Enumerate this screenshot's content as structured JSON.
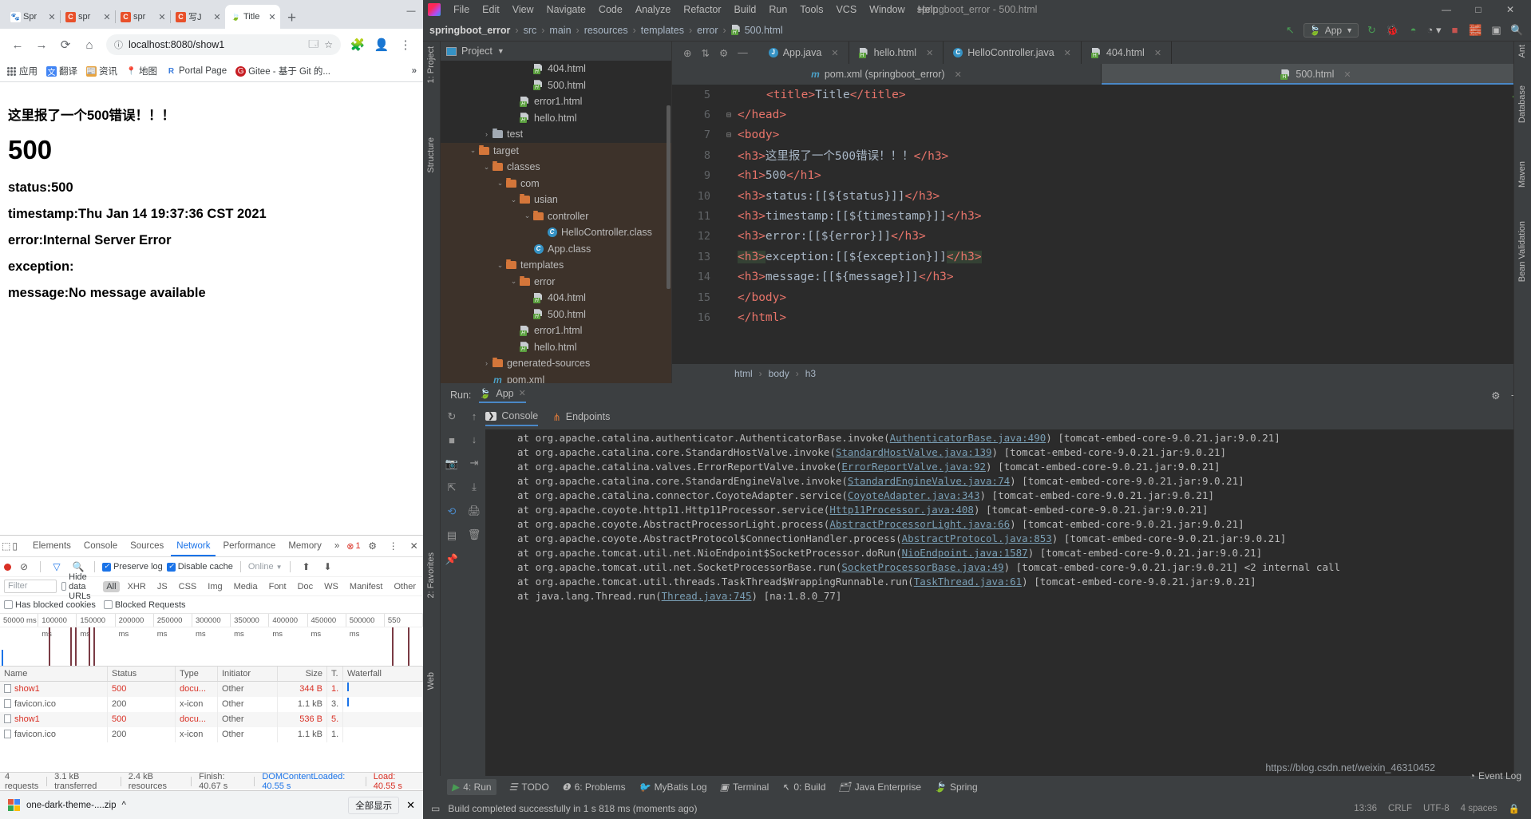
{
  "browser": {
    "tabs": [
      {
        "title": "Spr",
        "icon": "baidu-favicon",
        "active": false
      },
      {
        "title": "spr",
        "icon": "csdn-favicon",
        "active": false
      },
      {
        "title": "spr",
        "icon": "csdn-favicon",
        "active": false
      },
      {
        "title": "写J",
        "icon": "csdn-favicon",
        "active": false
      },
      {
        "title": "Title",
        "icon": "leaf-favicon",
        "active": true
      }
    ],
    "newtab_label": "+",
    "window_buttons": [
      "—",
      "□",
      "✕"
    ],
    "nav": {
      "back": "←",
      "forward": "→",
      "reload": "⟳",
      "home": "⌂"
    },
    "omnibox": {
      "info_icon": "ⓘ",
      "url": "localhost:8080/show1",
      "translate_icon": "translate-icon",
      "star_icon": "☆"
    },
    "toolbar_icons": [
      "puzzle-icon",
      "profile-icon",
      "menu-icon"
    ],
    "bookmarks": [
      {
        "label": "应用",
        "icon": "apps-grid"
      },
      {
        "label": "翻译",
        "icon": "translate"
      },
      {
        "label": "资讯",
        "icon": "news"
      },
      {
        "label": "地图",
        "icon": "maps"
      },
      {
        "label": "Portal Page",
        "icon": "portal"
      },
      {
        "label": "Gitee - 基于 Git 的...",
        "icon": "gitee"
      }
    ],
    "bookmarks_overflow": "»",
    "page": {
      "h3_error": "这里报了一个500错误！！！",
      "h1_code": "500",
      "status": "status:500",
      "timestamp": "timestamp:Thu Jan 14 19:37:36 CST 2021",
      "error": "error:Internal Server Error",
      "exception": "exception:",
      "message": "message:No message available"
    }
  },
  "devtools": {
    "tabs": [
      "Elements",
      "Console",
      "Sources",
      "Network",
      "Performance",
      "Memory"
    ],
    "active_tab": "Network",
    "overflow": "»",
    "error_count": "1",
    "settings_icon": "gear-icon",
    "more_icon": "kebab-icon",
    "close_icon": "✕",
    "inspect_icon": "inspect-icon",
    "device_icon": "device-toolbar-icon",
    "toolbar": {
      "record": "record-dot",
      "clear": "clear-icon",
      "filter": "filter-icon",
      "search": "search-icon",
      "preserve_log": "Preserve log",
      "preserve_log_checked": true,
      "disable_cache": "Disable cache",
      "disable_cache_checked": true,
      "throttle": "Online",
      "import_icon": "⬆",
      "export_icon": "⬇"
    },
    "filterbar": {
      "placeholder": "Filter",
      "hide_data_urls": "Hide data URLs",
      "types": [
        "All",
        "XHR",
        "JS",
        "CSS",
        "Img",
        "Media",
        "Font",
        "Doc",
        "WS",
        "Manifest",
        "Other"
      ],
      "active_type": "All",
      "has_blocked_cookies": "Has blocked cookies",
      "blocked_requests": "Blocked Requests"
    },
    "overview_ticks": [
      "50000 ms",
      "100000 ms",
      "150000 ms",
      "200000 ms",
      "250000 ms",
      "300000 ms",
      "350000 ms",
      "400000 ms",
      "450000 ms",
      "500000 ms",
      "550"
    ],
    "table": {
      "headers": [
        "Name",
        "Status",
        "Type",
        "Initiator",
        "Size",
        "T.",
        "Waterfall"
      ],
      "rows": [
        {
          "name": "show1",
          "status": "500",
          "type": "docu...",
          "initiator": "Other",
          "size": "344 B",
          "time": "1.",
          "error": true
        },
        {
          "name": "favicon.ico",
          "status": "200",
          "type": "x-icon",
          "initiator": "Other",
          "size": "1.1 kB",
          "time": "3.",
          "error": false
        },
        {
          "name": "show1",
          "status": "500",
          "type": "docu...",
          "initiator": "Other",
          "size": "536 B",
          "time": "5.",
          "error": true
        },
        {
          "name": "favicon.ico",
          "status": "200",
          "type": "x-icon",
          "initiator": "Other",
          "size": "1.1 kB",
          "time": "1.",
          "error": false
        }
      ]
    },
    "summary": {
      "requests": "4 requests",
      "transferred": "3.1 kB transferred",
      "resources": "2.4 kB resources",
      "finish": "Finish: 40.67 s",
      "dcl": "DOMContentLoaded: 40.55 s",
      "load": "Load: 40.55 s"
    }
  },
  "download_bar": {
    "file": "one-dark-theme-....zip",
    "chevron": "^",
    "show_all": "全部显示",
    "close": "✕"
  },
  "ide": {
    "window_title": "springboot_error - 500.html",
    "menu": [
      "File",
      "Edit",
      "View",
      "Navigate",
      "Code",
      "Analyze",
      "Refactor",
      "Build",
      "Run",
      "Tools",
      "VCS",
      "Window",
      "Help"
    ],
    "window_buttons": [
      "—",
      "□",
      "✕"
    ],
    "breadcrumbs": [
      "springboot_error",
      "src",
      "main",
      "resources",
      "templates",
      "error",
      "500.html"
    ],
    "run_config": "App",
    "toolbar_icons": [
      "back-arrow-icon",
      "run-icon",
      "debug-icon",
      "run-coverage-icon",
      "profile-icon",
      "stop-icon",
      "build-icon",
      "terminal-icon",
      "search-icon"
    ],
    "project_panel": {
      "title": "Project",
      "vertical_tab": "1: Project",
      "toolbar_icons": [
        "locate-icon",
        "collapse-icon",
        "settings-icon",
        "hide-icon"
      ],
      "tree": [
        {
          "label": "404.html",
          "icon": "html",
          "indent": 6,
          "arrow": "",
          "highlight": false
        },
        {
          "label": "500.html",
          "icon": "html",
          "indent": 6,
          "arrow": "",
          "highlight": false
        },
        {
          "label": "error1.html",
          "icon": "html",
          "indent": 5,
          "arrow": "",
          "highlight": false
        },
        {
          "label": "hello.html",
          "icon": "html",
          "indent": 5,
          "arrow": "",
          "highlight": false
        },
        {
          "label": "test",
          "icon": "folder-grey",
          "indent": 3,
          "arrow": "›",
          "highlight": false
        },
        {
          "label": "target",
          "icon": "folder-orange",
          "indent": 2,
          "arrow": "⌄",
          "highlight": true
        },
        {
          "label": "classes",
          "icon": "folder-orange",
          "indent": 3,
          "arrow": "⌄",
          "highlight": true
        },
        {
          "label": "com",
          "icon": "folder-orange",
          "indent": 4,
          "arrow": "⌄",
          "highlight": true
        },
        {
          "label": "usian",
          "icon": "folder-orange",
          "indent": 5,
          "arrow": "⌄",
          "highlight": true
        },
        {
          "label": "controller",
          "icon": "folder-orange",
          "indent": 6,
          "arrow": "⌄",
          "highlight": true
        },
        {
          "label": "HelloController.class",
          "icon": "class",
          "indent": 7,
          "arrow": "",
          "highlight": true
        },
        {
          "label": "App.class",
          "icon": "class",
          "indent": 6,
          "arrow": "",
          "highlight": true
        },
        {
          "label": "templates",
          "icon": "folder-orange",
          "indent": 4,
          "arrow": "⌄",
          "highlight": true
        },
        {
          "label": "error",
          "icon": "folder-orange",
          "indent": 5,
          "arrow": "⌄",
          "highlight": true
        },
        {
          "label": "404.html",
          "icon": "html",
          "indent": 6,
          "arrow": "",
          "highlight": true
        },
        {
          "label": "500.html",
          "icon": "html",
          "indent": 6,
          "arrow": "",
          "highlight": true
        },
        {
          "label": "error1.html",
          "icon": "html",
          "indent": 5,
          "arrow": "",
          "highlight": true
        },
        {
          "label": "hello.html",
          "icon": "html",
          "indent": 5,
          "arrow": "",
          "highlight": true
        },
        {
          "label": "generated-sources",
          "icon": "folder-orange",
          "indent": 3,
          "arrow": "›",
          "highlight": true
        },
        {
          "label": "pom.xml",
          "icon": "maven",
          "indent": 3,
          "arrow": "",
          "highlight": true
        }
      ]
    },
    "editor": {
      "tabs_row1": [
        {
          "label": "App.java",
          "icon": "java-run",
          "active": false
        },
        {
          "label": "hello.html",
          "icon": "html",
          "active": false
        },
        {
          "label": "HelloController.java",
          "icon": "class",
          "active": false
        },
        {
          "label": "404.html",
          "icon": "html",
          "active": false
        }
      ],
      "tabs_row2": [
        {
          "label": "pom.xml (springboot_error)",
          "icon": "maven",
          "active": false
        },
        {
          "label": "500.html",
          "icon": "html",
          "active": true
        }
      ],
      "lines": [
        {
          "num": "5",
          "fold": "",
          "indent": 4,
          "segs": [
            [
              "ctag",
              "<title>"
            ],
            [
              "ptext",
              "Title"
            ],
            [
              "ctag",
              "</title>"
            ]
          ]
        },
        {
          "num": "6",
          "fold": "⊟",
          "indent": 0,
          "segs": [
            [
              "ctag",
              "</head>"
            ]
          ]
        },
        {
          "num": "7",
          "fold": "⊟",
          "indent": 0,
          "segs": [
            [
              "ctag",
              "<body>"
            ]
          ]
        },
        {
          "num": "8",
          "fold": "",
          "indent": 0,
          "segs": [
            [
              "ctag",
              "<h3>"
            ],
            [
              "ptext",
              "这里报了一个500错误！！！"
            ],
            [
              "ctag",
              "</h3>"
            ]
          ]
        },
        {
          "num": "9",
          "fold": "",
          "indent": 0,
          "segs": [
            [
              "ctag",
              "<h1>"
            ],
            [
              "ptext",
              "500"
            ],
            [
              "ctag",
              "</h1>"
            ]
          ]
        },
        {
          "num": "10",
          "fold": "",
          "indent": 0,
          "segs": [
            [
              "ctag",
              "<h3>"
            ],
            [
              "ptext",
              "status:[[${status}]]"
            ],
            [
              "ctag",
              "</h3>"
            ]
          ]
        },
        {
          "num": "11",
          "fold": "",
          "indent": 0,
          "segs": [
            [
              "ctag",
              "<h3>"
            ],
            [
              "ptext",
              "timestamp:[[${timestamp}]]"
            ],
            [
              "ctag",
              "</h3>"
            ]
          ]
        },
        {
          "num": "12",
          "fold": "",
          "indent": 0,
          "segs": [
            [
              "ctag",
              "<h3>"
            ],
            [
              "ptext",
              "error:[[${error}]]"
            ],
            [
              "ctag",
              "</h3>"
            ]
          ]
        },
        {
          "num": "13",
          "fold": "",
          "indent": 0,
          "segs": [
            [
              "ctag",
              "<h3>"
            ],
            [
              "ptext",
              "exception:[[${exception}]]"
            ],
            [
              "ctag",
              "</h3>"
            ]
          ],
          "selected": true
        },
        {
          "num": "14",
          "fold": "",
          "indent": 0,
          "segs": [
            [
              "ctag",
              "<h3>"
            ],
            [
              "ptext",
              "message:[[${message}]]"
            ],
            [
              "ctag",
              "</h3>"
            ]
          ]
        },
        {
          "num": "15",
          "fold": "",
          "indent": 0,
          "segs": [
            [
              "ctag",
              "</body>"
            ]
          ]
        },
        {
          "num": "16",
          "fold": "",
          "indent": 0,
          "segs": [
            [
              "ctag",
              "</html>"
            ]
          ]
        }
      ],
      "breadcrumb": [
        "html",
        "body",
        "h3"
      ],
      "inspection_ok": "✓"
    },
    "run_panel": {
      "label": "Run:",
      "config": "App",
      "close": "✕",
      "subtabs": [
        "Console",
        "Endpoints"
      ],
      "active_subtab": "Console",
      "settings_icon": "gear-icon",
      "minimize_icon": "—",
      "side_icons": [
        "rerun-icon",
        "stop-icon",
        "camera-icon",
        "thread-dump-icon",
        "scroll-end-icon",
        "soft-wrap-icon",
        "print-icon",
        "trash-icon",
        "pin-icon"
      ],
      "console_lines": [
        "at org.apache.catalina.authenticator.AuthenticatorBase.invoke(AuthenticatorBase.java:490) [tomcat-embed-core-9.0.21.jar:9.0.21]",
        "at org.apache.catalina.core.StandardHostValve.invoke(StandardHostValve.java:139) [tomcat-embed-core-9.0.21.jar:9.0.21]",
        "at org.apache.catalina.valves.ErrorReportValve.invoke(ErrorReportValve.java:92) [tomcat-embed-core-9.0.21.jar:9.0.21]",
        "at org.apache.catalina.core.StandardEngineValve.invoke(StandardEngineValve.java:74) [tomcat-embed-core-9.0.21.jar:9.0.21]",
        "at org.apache.catalina.connector.CoyoteAdapter.service(CoyoteAdapter.java:343) [tomcat-embed-core-9.0.21.jar:9.0.21]",
        "at org.apache.coyote.http11.Http11Processor.service(Http11Processor.java:408) [tomcat-embed-core-9.0.21.jar:9.0.21]",
        "at org.apache.coyote.AbstractProcessorLight.process(AbstractProcessorLight.java:66) [tomcat-embed-core-9.0.21.jar:9.0.21]",
        "at org.apache.coyote.AbstractProtocol$ConnectionHandler.process(AbstractProtocol.java:853) [tomcat-embed-core-9.0.21.jar:9.0.21]",
        "at org.apache.tomcat.util.net.NioEndpoint$SocketProcessor.doRun(NioEndpoint.java:1587) [tomcat-embed-core-9.0.21.jar:9.0.21]",
        "at org.apache.tomcat.util.net.SocketProcessorBase.run(SocketProcessorBase.java:49) [tomcat-embed-core-9.0.21.jar:9.0.21] <2 internal call",
        "at org.apache.tomcat.util.threads.TaskThread$WrappingRunnable.run(TaskThread.java:61) [tomcat-embed-core-9.0.21.jar:9.0.21]",
        "at java.lang.Thread.run(Thread.java:745) [na:1.8.0_77]"
      ]
    },
    "right_strip": [
      "Ant",
      "Database",
      "Maven",
      "Bean Validation"
    ],
    "left_strip_bottom": [
      "Structure",
      "2: Favorites",
      "Web"
    ],
    "tool_window_bar": [
      {
        "label": "4: Run",
        "icon": "run-icon",
        "selected": true
      },
      {
        "label": "TODO",
        "icon": "todo-icon",
        "selected": false
      },
      {
        "label": "6: Problems",
        "icon": "problems-icon",
        "selected": false
      },
      {
        "label": "MyBatis Log",
        "icon": "mybatis-icon",
        "selected": false
      },
      {
        "label": "Terminal",
        "icon": "terminal-icon",
        "selected": false
      },
      {
        "label": "0: Build",
        "icon": "build-icon",
        "selected": false
      },
      {
        "label": "Java Enterprise",
        "icon": "java-enterprise-icon",
        "selected": false
      },
      {
        "label": "Spring",
        "icon": "spring-icon",
        "selected": false
      }
    ],
    "status_bar": {
      "message": "Build completed successfully in 1 s 818 ms (moments ago)",
      "time": "13:36",
      "line_sep": "CRLF",
      "encoding": "UTF-8",
      "indent": "4 spaces",
      "lock_icon": "lock-icon"
    },
    "event_log": "Event Log",
    "watermark": "https://blog.csdn.net/weixin_46310452"
  }
}
